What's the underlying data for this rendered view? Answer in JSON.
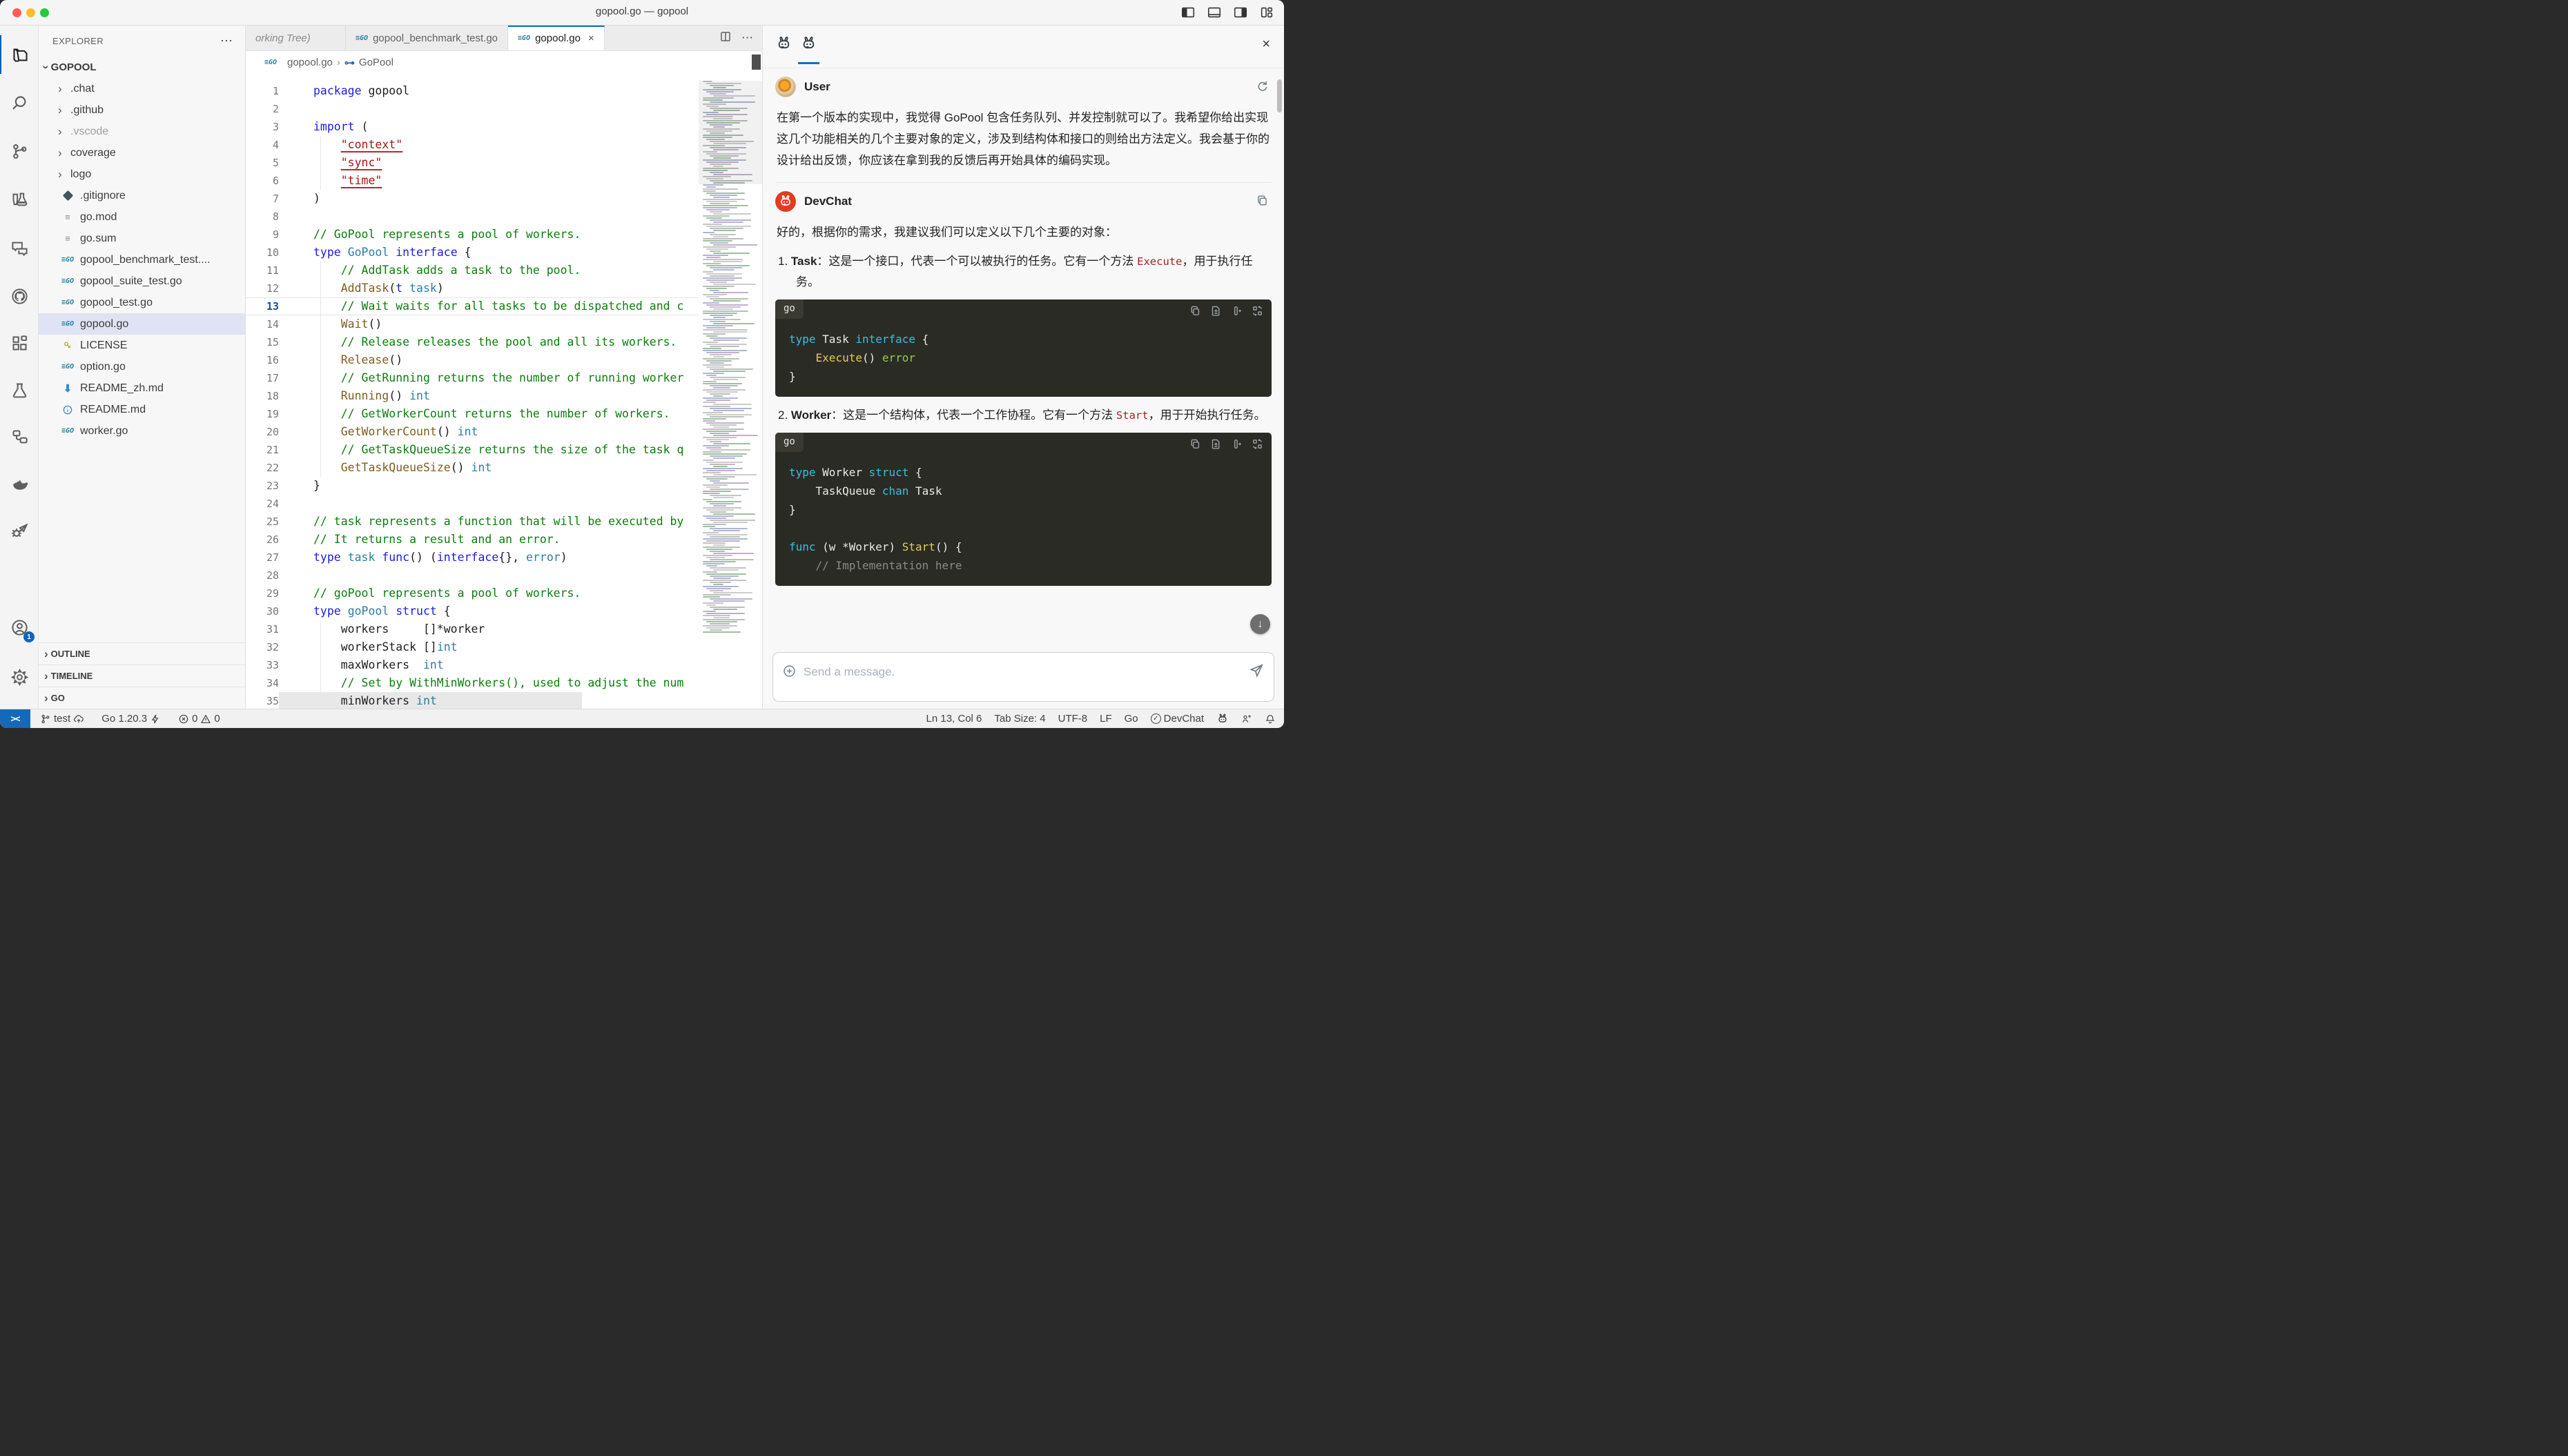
{
  "window": {
    "title": "gopool.go — gopool"
  },
  "activity_bar": {
    "items": [
      {
        "name": "explorer",
        "active": true
      },
      {
        "name": "search"
      },
      {
        "name": "source-control"
      },
      {
        "name": "testing"
      },
      {
        "name": "comments"
      },
      {
        "name": "github"
      },
      {
        "name": "extensions"
      },
      {
        "name": "flask"
      },
      {
        "name": "references"
      },
      {
        "name": "docker"
      },
      {
        "name": "run-debug"
      },
      {
        "name": "accounts",
        "badge": "1",
        "bottom": 0
      },
      {
        "name": "settings",
        "bottom": 1
      }
    ]
  },
  "explorer": {
    "title": "EXPLORER",
    "more": "⋯",
    "section": "GOPOOL",
    "items": [
      {
        "label": ".chat",
        "kind": "folder"
      },
      {
        "label": ".github",
        "kind": "folder"
      },
      {
        "label": ".vscode",
        "kind": "folder",
        "dim": true
      },
      {
        "label": "coverage",
        "kind": "folder"
      },
      {
        "label": "logo",
        "kind": "folder"
      },
      {
        "label": ".gitignore",
        "kind": "file",
        "icon": "diamond"
      },
      {
        "label": "go.mod",
        "kind": "file",
        "icon": "lines"
      },
      {
        "label": "go.sum",
        "kind": "file",
        "icon": "lines"
      },
      {
        "label": "gopool_benchmark_test....",
        "kind": "file",
        "icon": "go"
      },
      {
        "label": "gopool_suite_test.go",
        "kind": "file",
        "icon": "go"
      },
      {
        "label": "gopool_test.go",
        "kind": "file",
        "icon": "go"
      },
      {
        "label": "gopool.go",
        "kind": "file",
        "icon": "go",
        "selected": true
      },
      {
        "label": "LICENSE",
        "kind": "file",
        "icon": "key"
      },
      {
        "label": "option.go",
        "kind": "file",
        "icon": "go"
      },
      {
        "label": "README_zh.md",
        "kind": "file",
        "icon": "down"
      },
      {
        "label": "README.md",
        "kind": "file",
        "icon": "info"
      },
      {
        "label": "worker.go",
        "kind": "file",
        "icon": "go"
      }
    ],
    "bottom_sections": [
      "OUTLINE",
      "TIMELINE",
      "GO"
    ]
  },
  "tabs": {
    "partial": "orking Tree)",
    "tab2": "gopool_benchmark_test.go",
    "tab3": "gopool.go",
    "close": "×",
    "more": "⋯"
  },
  "breadcrumb": {
    "file": "gopool.go",
    "sep": "›",
    "symbol": "GoPool"
  },
  "editor": {
    "lines": [
      {
        "n": 1,
        "seg": [
          [
            "k",
            "package"
          ],
          [
            "t",
            " gopool"
          ]
        ]
      },
      {
        "n": 2,
        "seg": []
      },
      {
        "n": 3,
        "seg": [
          [
            "k",
            "import"
          ],
          [
            "t",
            " ("
          ]
        ]
      },
      {
        "n": 4,
        "seg": [
          [
            "t",
            "    "
          ],
          [
            "s",
            "\"context\""
          ]
        ]
      },
      {
        "n": 5,
        "seg": [
          [
            "t",
            "    "
          ],
          [
            "s",
            "\"sync\""
          ]
        ]
      },
      {
        "n": 6,
        "seg": [
          [
            "t",
            "    "
          ],
          [
            "s",
            "\"time\""
          ]
        ]
      },
      {
        "n": 7,
        "seg": [
          [
            "t",
            ")"
          ]
        ]
      },
      {
        "n": 8,
        "seg": []
      },
      {
        "n": 9,
        "seg": [
          [
            "c",
            "// GoPool represents a pool of workers."
          ]
        ]
      },
      {
        "n": 10,
        "seg": [
          [
            "k",
            "type"
          ],
          [
            "t",
            " "
          ],
          [
            "y",
            "GoPool"
          ],
          [
            "t",
            " "
          ],
          [
            "k",
            "interface"
          ],
          [
            "t",
            " {"
          ]
        ]
      },
      {
        "n": 11,
        "seg": [
          [
            "c",
            "    // AddTask adds a task to the pool."
          ]
        ]
      },
      {
        "n": 12,
        "seg": [
          [
            "t",
            "    "
          ],
          [
            "f",
            "AddTask"
          ],
          [
            "t",
            "("
          ],
          [
            "p",
            "t"
          ],
          [
            "t",
            " "
          ],
          [
            "y",
            "task"
          ],
          [
            "t",
            ")"
          ]
        ]
      },
      {
        "n": 13,
        "cur": true,
        "seg": [
          [
            "c",
            "    // Wait waits for all tasks to be dispatched and c"
          ]
        ]
      },
      {
        "n": 14,
        "seg": [
          [
            "t",
            "    "
          ],
          [
            "f",
            "Wait"
          ],
          [
            "t",
            "()"
          ]
        ]
      },
      {
        "n": 15,
        "seg": [
          [
            "c",
            "    // Release releases the pool and all its workers."
          ]
        ]
      },
      {
        "n": 16,
        "seg": [
          [
            "t",
            "    "
          ],
          [
            "f",
            "Release"
          ],
          [
            "t",
            "()"
          ]
        ]
      },
      {
        "n": 17,
        "seg": [
          [
            "c",
            "    // GetRunning returns the number of running worker"
          ]
        ]
      },
      {
        "n": 18,
        "seg": [
          [
            "t",
            "    "
          ],
          [
            "f",
            "Running"
          ],
          [
            "t",
            "() "
          ],
          [
            "y",
            "int"
          ]
        ]
      },
      {
        "n": 19,
        "seg": [
          [
            "c",
            "    // GetWorkerCount returns the number of workers."
          ]
        ]
      },
      {
        "n": 20,
        "seg": [
          [
            "t",
            "    "
          ],
          [
            "f",
            "GetWorkerCount"
          ],
          [
            "t",
            "() "
          ],
          [
            "y",
            "int"
          ]
        ]
      },
      {
        "n": 21,
        "seg": [
          [
            "c",
            "    // GetTaskQueueSize returns the size of the task q"
          ]
        ]
      },
      {
        "n": 22,
        "seg": [
          [
            "t",
            "    "
          ],
          [
            "f",
            "GetTaskQueueSize"
          ],
          [
            "t",
            "() "
          ],
          [
            "y",
            "int"
          ]
        ]
      },
      {
        "n": 23,
        "seg": [
          [
            "t",
            "}"
          ]
        ]
      },
      {
        "n": 24,
        "seg": []
      },
      {
        "n": 25,
        "seg": [
          [
            "c",
            "// task represents a function that will be executed by"
          ]
        ]
      },
      {
        "n": 26,
        "seg": [
          [
            "c",
            "// It returns a result and an error."
          ]
        ]
      },
      {
        "n": 27,
        "seg": [
          [
            "k",
            "type"
          ],
          [
            "t",
            " "
          ],
          [
            "y",
            "task"
          ],
          [
            "t",
            " "
          ],
          [
            "k",
            "func"
          ],
          [
            "t",
            "() ("
          ],
          [
            "k",
            "interface"
          ],
          [
            "t",
            "{}, "
          ],
          [
            "y",
            "error"
          ],
          [
            "t",
            ")"
          ]
        ]
      },
      {
        "n": 28,
        "seg": []
      },
      {
        "n": 29,
        "seg": [
          [
            "c",
            "// goPool represents a pool of workers."
          ]
        ]
      },
      {
        "n": 30,
        "seg": [
          [
            "k",
            "type"
          ],
          [
            "t",
            " "
          ],
          [
            "y",
            "goPool"
          ],
          [
            "t",
            " "
          ],
          [
            "k",
            "struct"
          ],
          [
            "t",
            " {"
          ]
        ]
      },
      {
        "n": 31,
        "seg": [
          [
            "t",
            "    workers     []*worker"
          ]
        ]
      },
      {
        "n": 32,
        "seg": [
          [
            "t",
            "    workerStack []"
          ],
          [
            "y",
            "int"
          ]
        ]
      },
      {
        "n": 33,
        "seg": [
          [
            "t",
            "    maxWorkers  "
          ],
          [
            "y",
            "int"
          ]
        ]
      },
      {
        "n": 34,
        "seg": [
          [
            "c",
            "    // Set by WithMinWorkers(), used to adjust the num"
          ]
        ]
      },
      {
        "n": 35,
        "sel": true,
        "seg": [
          [
            "t",
            "    minWorkers "
          ],
          [
            "y",
            "int"
          ]
        ]
      }
    ]
  },
  "chat": {
    "close": "×",
    "user": {
      "name": "User",
      "message": "在第一个版本的实现中，我觉得 GoPool 包含任务队列、并发控制就可以了。我希望你给出实现这几个功能相关的几个主要对象的定义，涉及到结构体和接口的则给出方法定义。我会基于你的设计给出反馈，你应该在拿到我的反馈后再开始具体的编码实现。"
    },
    "assistant": {
      "name": "DevChat",
      "intro": "好的，根据你的需求，我建议我们可以定义以下几个主要的对象：",
      "items": [
        {
          "num": "1. ",
          "bold": "Task",
          "before": "：这是一个接口，代表一个可以被执行的任务。它有一个方法 ",
          "code": "Execute",
          "after": "，用于执行任务。"
        },
        {
          "num": "2. ",
          "bold": "Worker",
          "before": "：这是一个结构体，代表一个工作协程。它有一个方法 ",
          "code": "Start",
          "after": "，用于开始执行任务。"
        }
      ],
      "code_blocks": [
        {
          "lang": "go",
          "lines": [
            [
              [
                "dk",
                "type"
              ],
              [
                "dw",
                " Task "
              ],
              [
                "dk",
                "interface"
              ],
              [
                "dw",
                " {"
              ]
            ],
            [
              [
                "dw",
                "    "
              ],
              [
                "dy",
                "Execute"
              ],
              [
                "dw",
                "() "
              ],
              [
                "dg",
                "error"
              ]
            ],
            [
              [
                "dw",
                "}"
              ]
            ]
          ]
        },
        {
          "lang": "go",
          "lines": [
            [
              [
                "dk",
                "type"
              ],
              [
                "dw",
                " Worker "
              ],
              [
                "dk",
                "struct"
              ],
              [
                "dw",
                " {"
              ]
            ],
            [
              [
                "dw",
                "    TaskQueue "
              ],
              [
                "dk",
                "chan"
              ],
              [
                "dw",
                " Task"
              ]
            ],
            [
              [
                "dw",
                "}"
              ]
            ],
            [
              [
                "dw",
                ""
              ]
            ],
            [
              [
                "dk",
                "func"
              ],
              [
                "dw",
                " (w *Worker) "
              ],
              [
                "dy",
                "Start"
              ],
              [
                "dw",
                "() {"
              ]
            ],
            [
              [
                "dc",
                "    // Implementation here"
              ]
            ]
          ]
        }
      ]
    },
    "input": {
      "placeholder": "Send a message."
    }
  },
  "status_bar": {
    "remote": "><",
    "branch": "test",
    "go_version": "Go 1.20.3",
    "errors": "0",
    "warnings": "0",
    "right": {
      "cursor": "Ln 13, Col 6",
      "tabsize": "Tab Size: 4",
      "encoding": "UTF-8",
      "eol": "LF",
      "lang": "Go",
      "devchat": "DevChat"
    }
  }
}
